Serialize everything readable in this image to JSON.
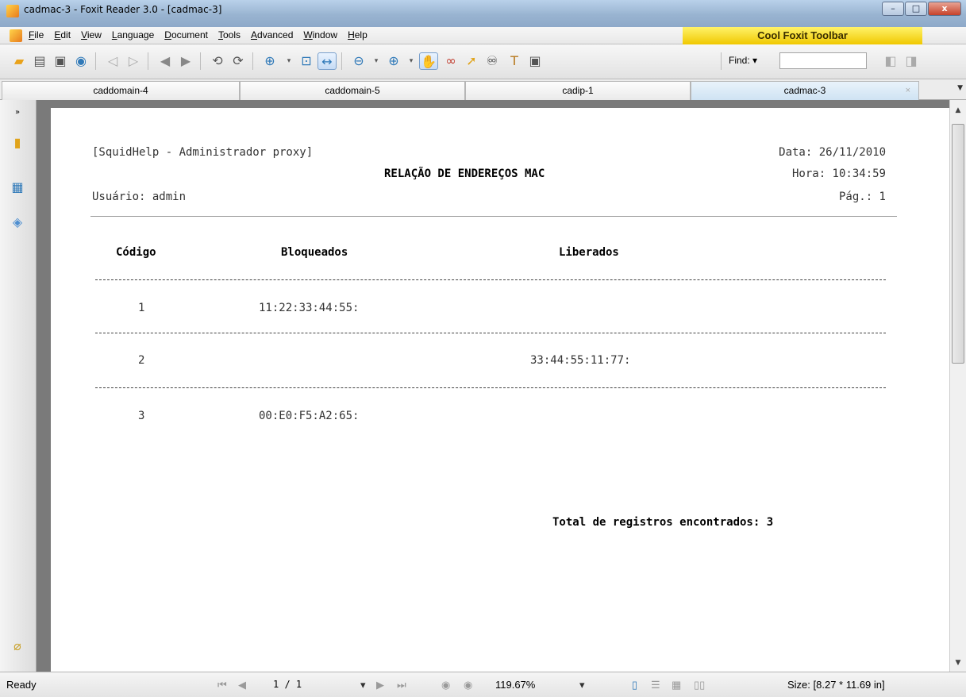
{
  "window": {
    "title": "cadmac-3 - Foxit Reader 3.0 - [cadmac-3]",
    "minimize": "–",
    "maximize": "□",
    "close": "x"
  },
  "menu": {
    "items": [
      "File",
      "Edit",
      "View",
      "Language",
      "Document",
      "Tools",
      "Advanced",
      "Window",
      "Help"
    ],
    "banner": "Cool Foxit Toolbar"
  },
  "toolbar": {
    "find_label": "Find:",
    "find_value": ""
  },
  "tabs": [
    {
      "label": "caddomain-4"
    },
    {
      "label": "caddomain-5"
    },
    {
      "label": "cadip-1"
    },
    {
      "label": "cadmac-3",
      "close": "×"
    }
  ],
  "report": {
    "system": "[SquidHelp - Administrador proxy]",
    "title": "RELAÇÃO DE ENDEREÇOS MAC",
    "user": "Usuário: admin",
    "date": "Data: 26/11/2010",
    "time": "Hora: 10:34:59",
    "page": "Pág.: 1",
    "columns": [
      "Código",
      "Bloqueados",
      "Liberados"
    ],
    "rows": [
      {
        "codigo": "1",
        "bloqueado": "11:22:33:44:55:",
        "liberado": ""
      },
      {
        "codigo": "2",
        "bloqueado": "",
        "liberado": "33:44:55:11:77:"
      },
      {
        "codigo": "3",
        "bloqueado": "00:E0:F5:A2:65:",
        "liberado": ""
      }
    ],
    "total": "Total de registros encontrados: 3"
  },
  "status": {
    "ready": "Ready",
    "page_indicator": "1 / 1",
    "zoom": "119.67%",
    "size": "Size: [8.27 * 11.69 in]"
  }
}
